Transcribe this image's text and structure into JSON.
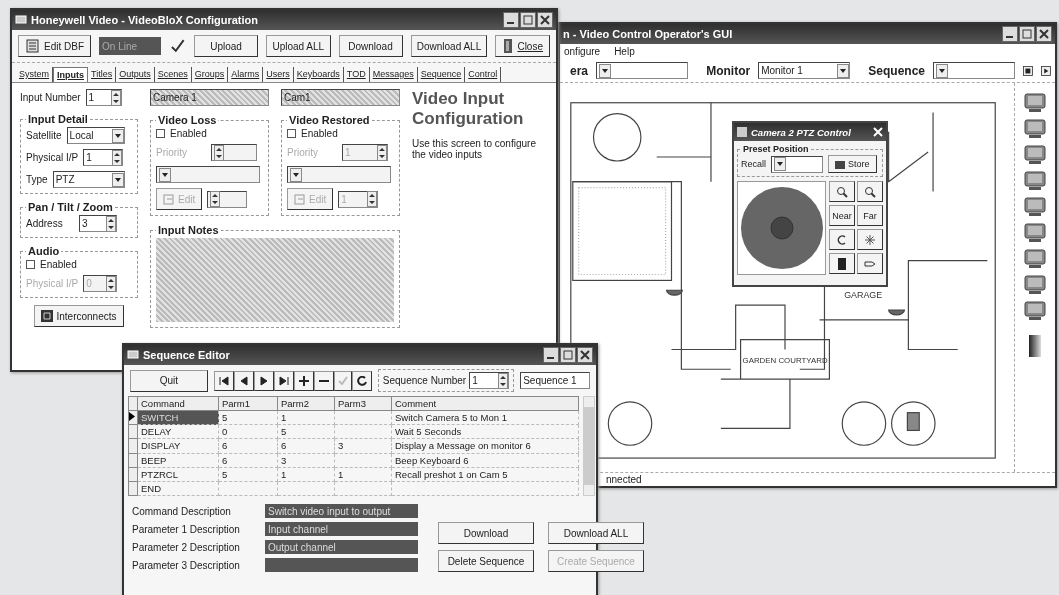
{
  "operator_window": {
    "title": "n - Video Control Operator's GUI",
    "menu": [
      "onfigure",
      "Help"
    ],
    "camera_label": "era",
    "monitor": {
      "label": "Monitor",
      "value": "Monitor 1"
    },
    "sequence_label": "Sequence",
    "floor_labels": [
      "GARAGE",
      "GARDEN COURTYARD"
    ],
    "status": "nnected",
    "ptz_window": {
      "title": "Camera 2 PTZ Control",
      "preset_title": "Preset Position",
      "recall_label": "Recall",
      "store_button": "Store",
      "focus_buttons": [
        "Near",
        "Far"
      ]
    }
  },
  "config_window": {
    "title": "Honeywell Video - VideoBloX Configuration",
    "toolbar": {
      "edit_button": "Edit DBF",
      "status": "On Line",
      "buttons": [
        "Upload",
        "Upload ALL",
        "Download",
        "Download ALL"
      ],
      "close_button": "Close"
    },
    "tabs": [
      {
        "label": "System",
        "selected": false
      },
      {
        "label": "Inputs",
        "selected": true
      },
      {
        "label": "Titles",
        "selected": false
      },
      {
        "label": "Outputs",
        "selected": false
      },
      {
        "label": "Scenes",
        "selected": false
      },
      {
        "label": "Groups",
        "selected": false
      },
      {
        "label": "Alarms",
        "selected": false
      },
      {
        "label": "Users",
        "selected": false
      },
      {
        "label": "Keyboards",
        "selected": false
      },
      {
        "label": "TOD",
        "selected": false
      },
      {
        "label": "Messages",
        "selected": false
      },
      {
        "label": "Sequence",
        "selected": false
      },
      {
        "label": "Control",
        "selected": false
      }
    ],
    "input_number": {
      "label": "Input Number",
      "value": "1"
    },
    "title_fields": [
      "Camera 1",
      "Cam1"
    ],
    "input_detail": {
      "title": "Input Detail",
      "satellite": {
        "label": "Satellite",
        "value": "Local"
      },
      "physical_ip": {
        "label": "Physical I/P",
        "value": "1"
      },
      "type": {
        "label": "Type",
        "value": "PTZ"
      }
    },
    "ptz": {
      "title": "Pan / Tilt / Zoom",
      "address": {
        "label": "Address",
        "value": "3"
      }
    },
    "audio": {
      "title": "Audio",
      "enabled": {
        "label": "Enabled",
        "checked": false
      },
      "physical_ip": {
        "label": "Physical I/P",
        "value": "0",
        "disabled": true
      }
    },
    "interconnects_button": "Interconnects",
    "video_groups": [
      {
        "title": "Video Loss",
        "enabled": {
          "label": "Enabled",
          "checked": false
        },
        "priority_label": "Priority",
        "disabled": true,
        "edit_button": "Edit"
      },
      {
        "title": "Video Restored",
        "enabled": {
          "label": "Enabled",
          "checked": false
        },
        "priority_label": "Priority",
        "priority_value": "1",
        "edit_value": "1",
        "disabled": true,
        "edit_button": "Edit"
      }
    ],
    "input_notes_title": "Input Notes",
    "info": {
      "heading": "Video Input Configuration",
      "text": "Use this screen to configure the video inputs"
    }
  },
  "sequence_editor": {
    "title": "Sequence Editor",
    "quit_button": "Quit",
    "sequence_number": {
      "label": "Sequence Number",
      "value": "1"
    },
    "sequence_name": "Sequence 1",
    "table": {
      "columns": [
        "Command",
        "Parm1",
        "Parm2",
        "Parm3",
        "Comment"
      ],
      "rows": [
        {
          "cells": [
            "SWITCH",
            "5",
            "1",
            null,
            "Switch Camera 5 to Mon 1"
          ],
          "selected": true
        },
        {
          "cells": [
            "DELAY",
            "0",
            "5",
            null,
            "Wait 5 Seconds"
          ],
          "selected": false
        },
        {
          "cells": [
            "DISPLAY",
            "6",
            "6",
            "3",
            "Display a Message on monitor 6"
          ],
          "selected": false
        },
        {
          "cells": [
            "BEEP",
            "6",
            "3",
            null,
            "Beep Keyboard 6"
          ],
          "selected": false
        },
        {
          "cells": [
            "PTZRCL",
            "5",
            "1",
            "1",
            "Recall preshot 1 on Cam 5"
          ],
          "selected": false
        },
        {
          "cells": [
            "END",
            null,
            null,
            null,
            null
          ],
          "selected": false
        }
      ]
    },
    "descriptions": [
      {
        "label": "Command Description",
        "value": "Switch video input to output"
      },
      {
        "label": "Parameter 1 Description",
        "value": "Input channel"
      },
      {
        "label": "Parameter 2 Description",
        "value": "Output channel"
      },
      {
        "label": "Parameter 3 Description"
      }
    ],
    "buttons": [
      {
        "label": "Download",
        "disabled": false
      },
      {
        "label": "Download ALL",
        "disabled": false
      },
      {
        "label": "Delete Sequence",
        "disabled": false
      },
      {
        "label": "Create Sequence",
        "disabled": true
      }
    ]
  }
}
